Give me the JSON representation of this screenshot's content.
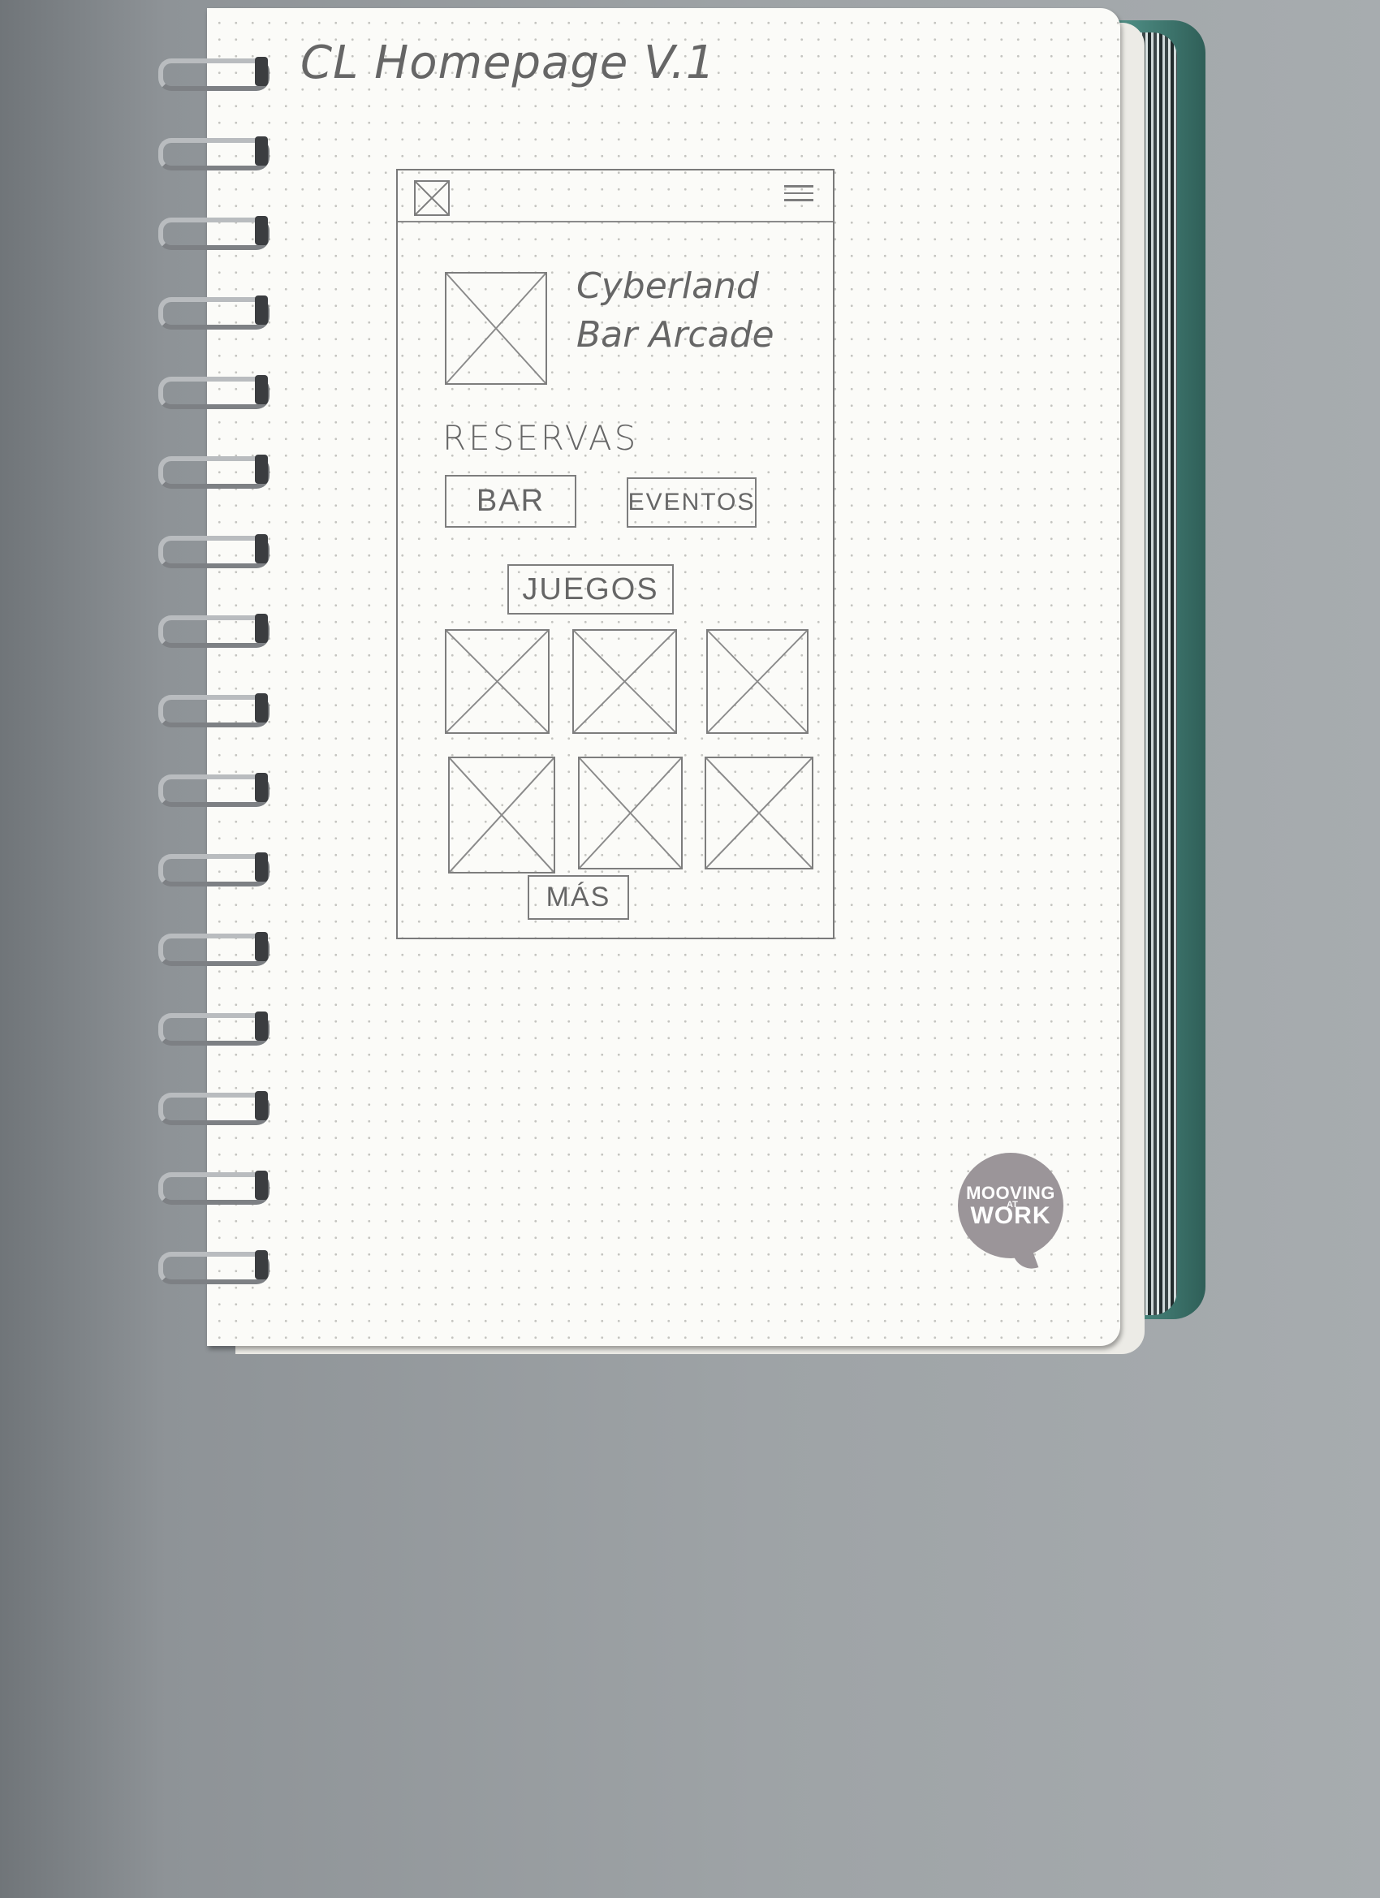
{
  "page_title": "CL Homepage V.1",
  "wireframe": {
    "header": {
      "logo_icon": "image-placeholder-icon",
      "menu_icon": "hamburger-menu-icon"
    },
    "hero": {
      "image_icon": "image-placeholder-icon",
      "brand_line1": "Cyberland",
      "brand_line2": "Bar Arcade"
    },
    "reservas": {
      "heading": "RESERVAS",
      "bar_button": "BAR",
      "eventos_button": "EVENTOS"
    },
    "juegos": {
      "button": "JUEGOS",
      "thumbnails": [
        "image-placeholder-icon",
        "image-placeholder-icon",
        "image-placeholder-icon",
        "image-placeholder-icon",
        "image-placeholder-icon",
        "image-placeholder-icon"
      ],
      "more_button": "MÁS"
    }
  },
  "notebook_logo": {
    "line1": "MOOVING",
    "line2": "WORK",
    "small": "AT"
  }
}
